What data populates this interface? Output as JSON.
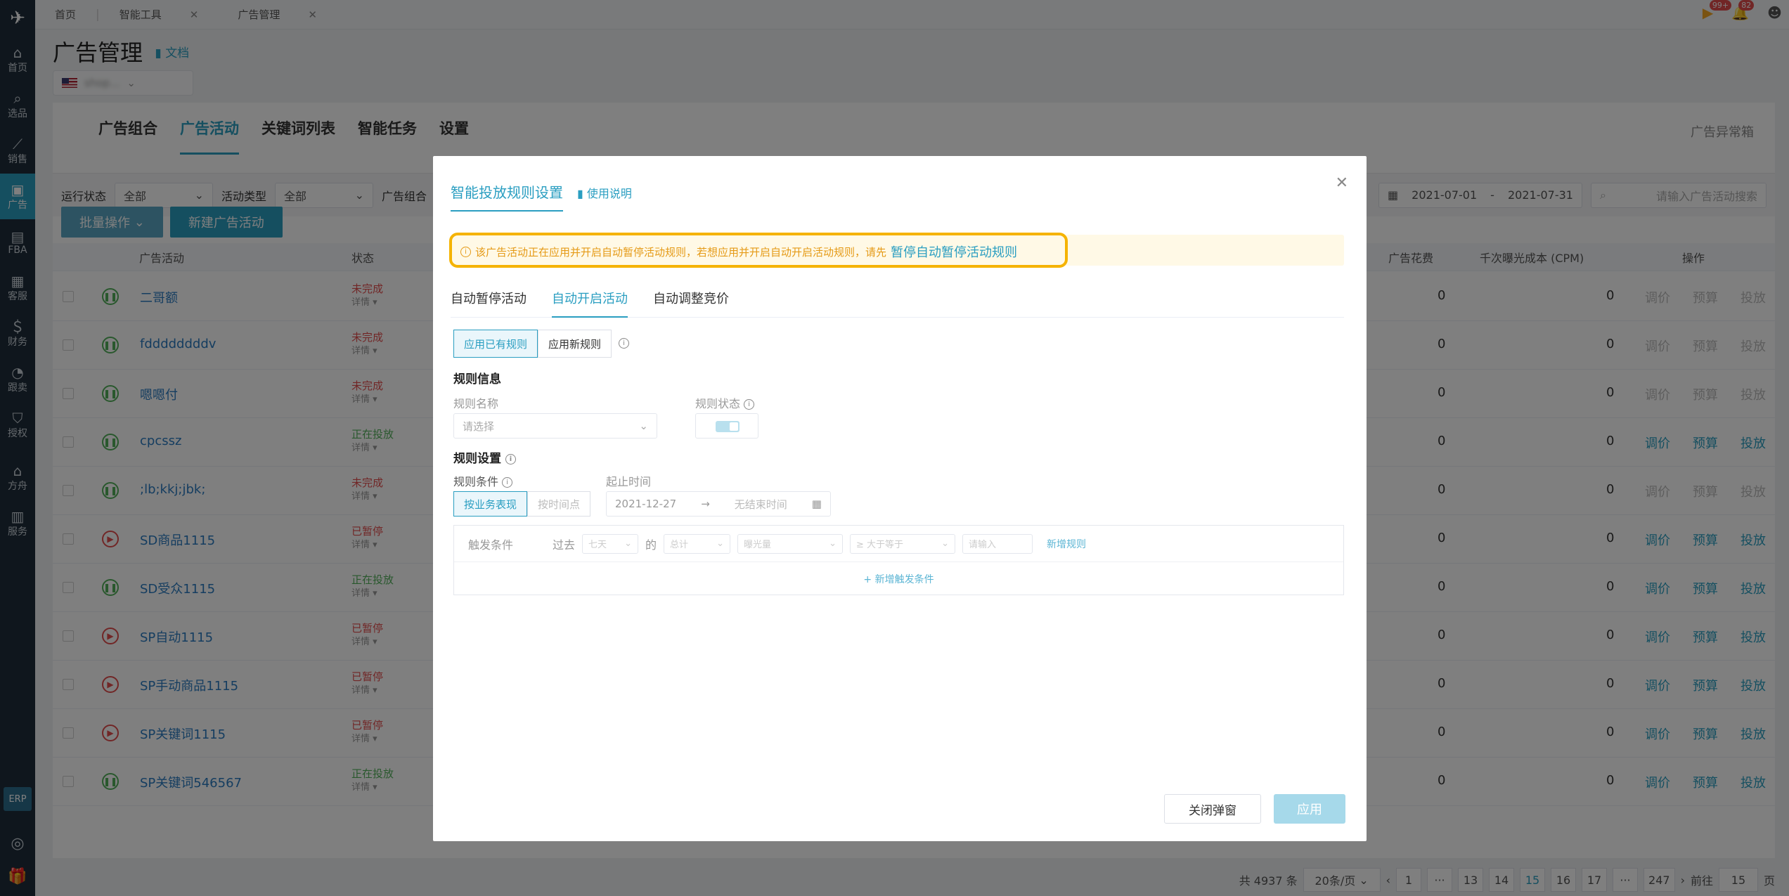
{
  "topbar": {
    "tabs": [
      {
        "label": "首页"
      },
      {
        "label": "智能工具"
      },
      {
        "label": "广告管理"
      }
    ],
    "badges": {
      "notify_count": "99+",
      "message_count": "82"
    }
  },
  "leftnav": {
    "items": [
      {
        "label": "首页",
        "icon": "home-icon"
      },
      {
        "label": "选品",
        "icon": "search-icon"
      },
      {
        "label": "销售",
        "icon": "trend-icon"
      },
      {
        "label": "广告",
        "icon": "ad-icon"
      },
      {
        "label": "FBA",
        "icon": "box-icon"
      },
      {
        "label": "客服",
        "icon": "chat-icon"
      },
      {
        "label": "财务",
        "icon": "dollar-icon"
      },
      {
        "label": "跟卖",
        "icon": "pie-icon"
      },
      {
        "label": "授权",
        "icon": "shield-icon"
      },
      {
        "label": "方舟",
        "icon": "ark-icon"
      },
      {
        "label": "服务",
        "icon": "briefcase-icon"
      }
    ],
    "erp": "ERP"
  },
  "header": {
    "title": "广告管理",
    "doc_link": "文档"
  },
  "main": {
    "tabs": [
      {
        "label": "广告组合",
        "active": false
      },
      {
        "label": "广告活动",
        "active": true
      },
      {
        "label": "关键词列表",
        "active": false
      },
      {
        "label": "智能任务",
        "active": false
      },
      {
        "label": "设置",
        "active": false
      }
    ],
    "abnormal_box": "广告异常箱",
    "filters": {
      "run_status_label": "运行状态",
      "run_status_value": "全部",
      "type_label": "活动类型",
      "type_value": "全部",
      "group_label": "广告组合",
      "date_start": "2021-07-01",
      "date_end": "2021-07-31",
      "search_placeholder": "请输入广告活动搜索"
    },
    "actions": {
      "batch": "批量操作",
      "new": "新建广告活动"
    },
    "columns": {
      "campaign": "广告活动",
      "status": "状态",
      "spend": "广告花费",
      "cpm": "千次曝光成本 (CPM)",
      "ops": "操作"
    },
    "rows": [
      {
        "name": "二哥额",
        "status": "未完成",
        "detail": "详情",
        "state": "run",
        "spend": "0",
        "cpm": "0",
        "enabled": false
      },
      {
        "name": "fddddddddv",
        "status": "未完成",
        "detail": "详情",
        "state": "run",
        "spend": "0",
        "cpm": "0",
        "enabled": false
      },
      {
        "name": "嗯嗯付",
        "status": "未完成",
        "detail": "详情",
        "state": "run",
        "spend": "0",
        "cpm": "0",
        "enabled": false
      },
      {
        "name": "cpcssz",
        "status": "正在投放",
        "detail": "详情",
        "state": "run",
        "spend": "0",
        "cpm": "0",
        "enabled": true
      },
      {
        "name": ";lb;kkj;jbk;",
        "status": "未完成",
        "detail": "详情",
        "state": "run",
        "spend": "0",
        "cpm": "0",
        "enabled": false
      },
      {
        "name": "SD商品1115",
        "status": "已暂停",
        "detail": "详情",
        "state": "pause",
        "spend": "0",
        "cpm": "0",
        "enabled": true
      },
      {
        "name": "SD受众1115",
        "status": "正在投放",
        "detail": "详情",
        "state": "run",
        "spend": "0",
        "cpm": "0",
        "enabled": true
      },
      {
        "name": "SP自动1115",
        "status": "已暂停",
        "detail": "详情",
        "state": "pause",
        "spend": "0",
        "cpm": "0",
        "enabled": true
      },
      {
        "name": "SP手动商品1115",
        "status": "已暂停",
        "detail": "详情",
        "state": "pause",
        "spend": "0",
        "cpm": "0",
        "enabled": true
      },
      {
        "name": "SP关键词1115",
        "status": "已暂停",
        "detail": "详情",
        "state": "pause",
        "spend": "0",
        "cpm": "0",
        "enabled": true
      },
      {
        "name": "SP关键词546567",
        "status": "正在投放",
        "detail": "详情",
        "state": "run",
        "spend": "0",
        "cpm": "0",
        "enabled": true
      }
    ],
    "row_ops": {
      "adjust": "调价",
      "budget": "预算",
      "launch": "投放"
    }
  },
  "pager": {
    "total": "共 4937 条",
    "page_size": "20条/页",
    "pages": [
      "1",
      "···",
      "13",
      "14",
      "15",
      "16",
      "17",
      "···",
      "247"
    ],
    "current": "15",
    "goto_label": "前往",
    "goto_value": "15",
    "goto_unit": "页"
  },
  "modal": {
    "title": "智能投放规则设置",
    "help": "使用说明",
    "warning_text": "该广告活动正在应用并开启自动暂停活动规则，若想应用并开启自动开启活动规则，请先",
    "warning_link": "暂停自动暂停活动规则",
    "tabs": [
      {
        "label": "自动暂停活动",
        "active": false
      },
      {
        "label": "自动开启活动",
        "active": true
      },
      {
        "label": "自动调整竞价",
        "active": false
      }
    ],
    "mode": {
      "existing": "应用已有规则",
      "new": "应用新规则"
    },
    "rule_info_title": "规则信息",
    "rule_name_label": "规则名称",
    "rule_name_placeholder": "请选择",
    "rule_status_label": "规则状态",
    "rule_settings_title": "规则设置",
    "condition_label": "规则条件",
    "condition_by_perf": "按业务表现",
    "condition_by_time": "按时间点",
    "time_label": "起止时间",
    "time_start": "2021-12-27",
    "time_end_placeholder": "无结束时间",
    "trigger": {
      "label": "触发条件",
      "past": "过去",
      "days": "七天",
      "of": "的",
      "agg": "总计",
      "metric": "曝光量",
      "op": "≥ 大于等于",
      "value_placeholder": "请输入",
      "add_rule": "新增规则",
      "add_condition": "+ 新增触发条件"
    },
    "close_button": "关闭弹窗",
    "apply_button": "应用"
  }
}
